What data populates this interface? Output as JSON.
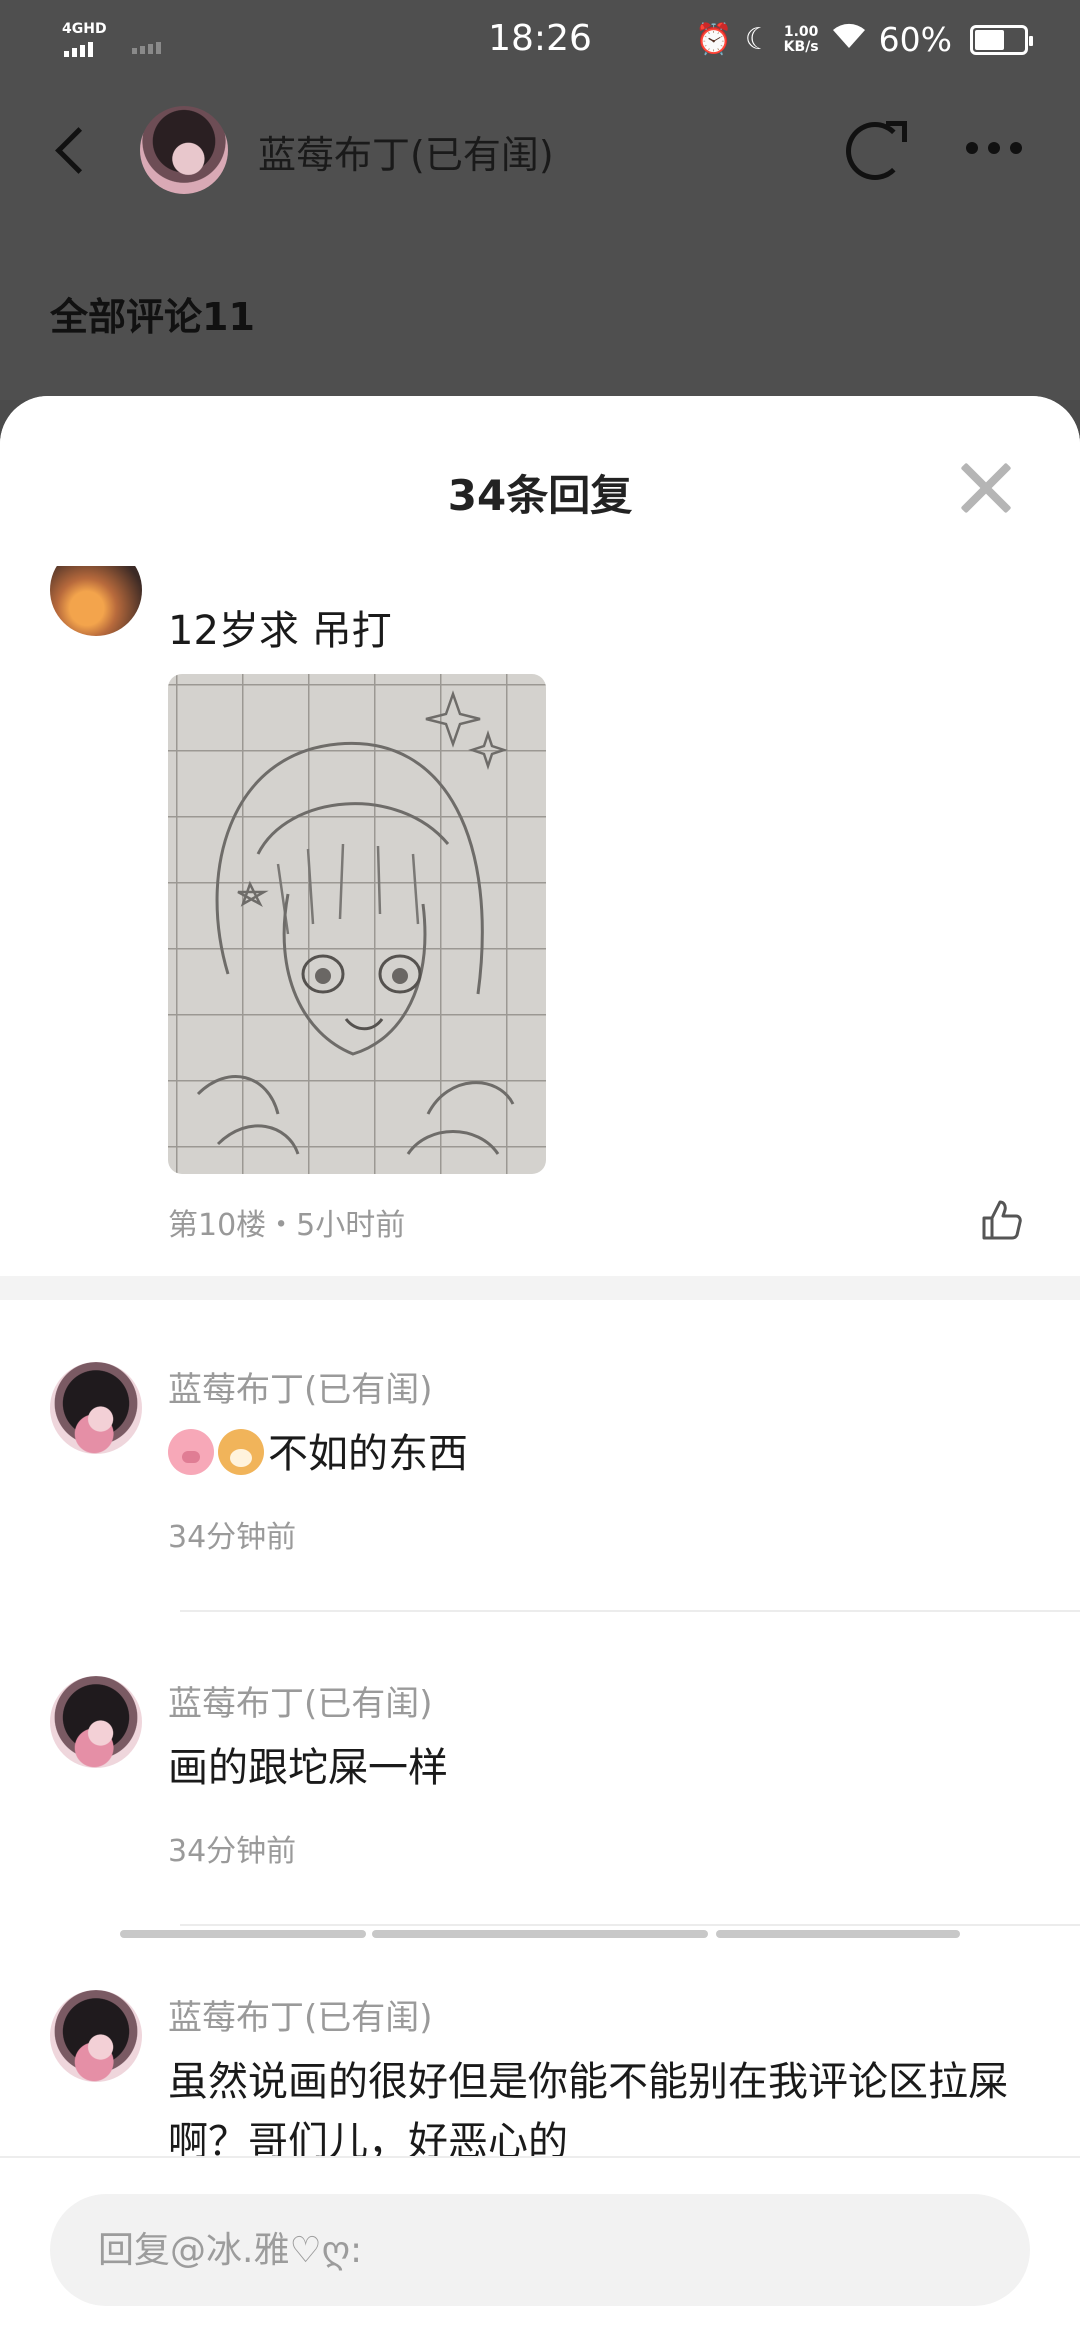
{
  "status_bar": {
    "network": "4GHD",
    "time": "18:26",
    "icons": [
      "alarm-icon",
      "moon-icon",
      "wifi-icon"
    ],
    "speed": "1.00",
    "speed_unit": "KB/s",
    "battery": "60%",
    "battery_level": 0.6
  },
  "nav": {
    "title": "蓝莓布丁(已有闺)",
    "icons": [
      "back-icon",
      "share-icon",
      "more-icon"
    ]
  },
  "page": {
    "all_comments": "全部评论11"
  },
  "sheet": {
    "title": "34条回复",
    "close_icon": "close-icon"
  },
  "main_comment": {
    "text": "12岁求 吊打",
    "meta": "第10楼・5小时前",
    "like_icon": "thumb-up-icon"
  },
  "replies": [
    {
      "author": "蓝莓布丁(已有闺)",
      "emojis": [
        "pig-emoji",
        "dog-emoji"
      ],
      "text": "不如的东西",
      "time": "34分钟前"
    },
    {
      "author": "蓝莓布丁(已有闺)",
      "text": "画的跟坨屎一样",
      "time": "34分钟前"
    },
    {
      "author": "蓝莓布丁(已有闺)",
      "text": "虽然说画的很好但是你能不能别在我评论区拉屎啊？哥们儿，好恶心的",
      "time": ""
    }
  ],
  "input": {
    "placeholder": "回复@冰.雅♡ღ:"
  },
  "colors": {
    "overlay": "#4f4f4f",
    "sheet": "#ffffff",
    "secondary_text": "#9a9a9a",
    "input_bg": "#f2f2f2"
  }
}
